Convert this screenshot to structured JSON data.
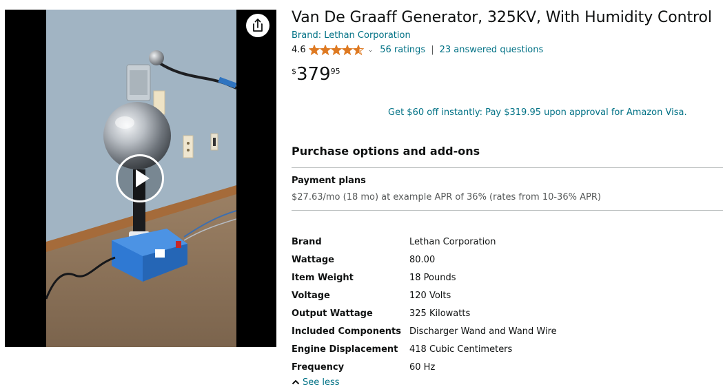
{
  "product": {
    "title": "Van De Graaff Generator, 325KV, With Humidity Control",
    "brand_link": "Brand: Lethan Corporation",
    "rating_value": "4.6",
    "ratings_link": "56 ratings",
    "ratings_separator": "|",
    "questions_link": "23 answered questions",
    "star_rating": 4.6
  },
  "price": {
    "symbol": "$",
    "whole": "379",
    "fraction": "95"
  },
  "promo": {
    "text": "Get $60 off instantly: Pay $319.95 upon approval for Amazon Visa."
  },
  "purchase_options": {
    "title": "Purchase options and add-ons",
    "payment_plans_title": "Payment plans",
    "payment_plans_text": "$27.63/mo (18 mo) at example APR of 36% (rates from 10-36% APR)"
  },
  "specs": [
    {
      "label": "Brand",
      "value": "Lethan Corporation"
    },
    {
      "label": "Wattage",
      "value": "80.00"
    },
    {
      "label": "Item Weight",
      "value": "18 Pounds"
    },
    {
      "label": "Voltage",
      "value": "120 Volts"
    },
    {
      "label": "Output Wattage",
      "value": "325 Kilowatts"
    },
    {
      "label": "Included Components",
      "value": "Discharger Wand and Wand Wire"
    },
    {
      "label": "Engine Displacement",
      "value": "418 Cubic Centimeters"
    },
    {
      "label": "Frequency",
      "value": "60 Hz"
    }
  ],
  "see_less": "See less",
  "icons": {
    "share": "share-icon",
    "play": "play-icon",
    "stars": "star-rating-icon",
    "chevron": "chevron-down-icon",
    "caret": "caret-up-icon"
  },
  "colors": {
    "link": "#007185",
    "star": "#de7921",
    "text": "#0f1111",
    "muted": "#565959"
  }
}
